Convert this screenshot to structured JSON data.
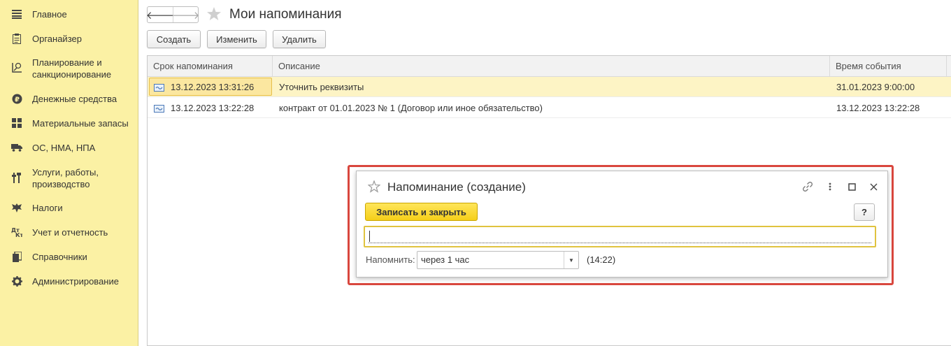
{
  "sidebar": {
    "items": [
      {
        "label": "Главное",
        "icon": "menu-lines-icon"
      },
      {
        "label": "Органайзер",
        "icon": "clipboard-icon"
      },
      {
        "label": "Планирование и санкционирование",
        "icon": "planning-chart-icon"
      },
      {
        "label": "Денежные средства",
        "icon": "ruble-coin-icon"
      },
      {
        "label": "Материальные запасы",
        "icon": "grid-boxes-icon"
      },
      {
        "label": "ОС, НМА, НПА",
        "icon": "truck-icon"
      },
      {
        "label": "Услуги, работы, производство",
        "icon": "tools-icon"
      },
      {
        "label": "Налоги",
        "icon": "eagle-emblem-icon"
      },
      {
        "label": "Учет и отчетность",
        "icon": "debit-credit-icon"
      },
      {
        "label": "Справочники",
        "icon": "books-icon"
      },
      {
        "label": "Администрирование",
        "icon": "gear-icon"
      }
    ]
  },
  "header": {
    "back_glyph": "🡐",
    "forward_glyph": "🡒",
    "title": "Мои напоминания"
  },
  "toolbar": {
    "create_label": "Создать",
    "edit_label": "Изменить",
    "delete_label": "Удалить"
  },
  "table": {
    "columns": [
      "Срок напоминания",
      "Описание",
      "Время события"
    ],
    "rows": [
      {
        "due": "13.12.2023 13:31:26",
        "description": "Уточнить реквизиты",
        "event_time": "31.01.2023 9:00:00",
        "selected": true
      },
      {
        "due": "13.12.2023 13:22:28",
        "description": "контракт от 01.01.2023 № 1 (Договор или иное обязательство)",
        "event_time": "13.12.2023 13:22:28",
        "selected": false
      }
    ]
  },
  "dialog": {
    "title": "Напоминание (создание)",
    "save_close_label": "Записать и закрыть",
    "help_label": "?",
    "text_value": "",
    "remind_label": "Напомнить:",
    "remind_value": "через 1 час",
    "remind_time": "(14:22)",
    "icons": [
      "link-icon",
      "more-vertical-icon",
      "maximize-icon",
      "close-icon"
    ]
  },
  "colors": {
    "sidebar_bg": "#fbf1a4",
    "selected_row": "#fdf4c5",
    "primary_button": "#f5cf19",
    "highlight_frame": "#d9473e"
  }
}
